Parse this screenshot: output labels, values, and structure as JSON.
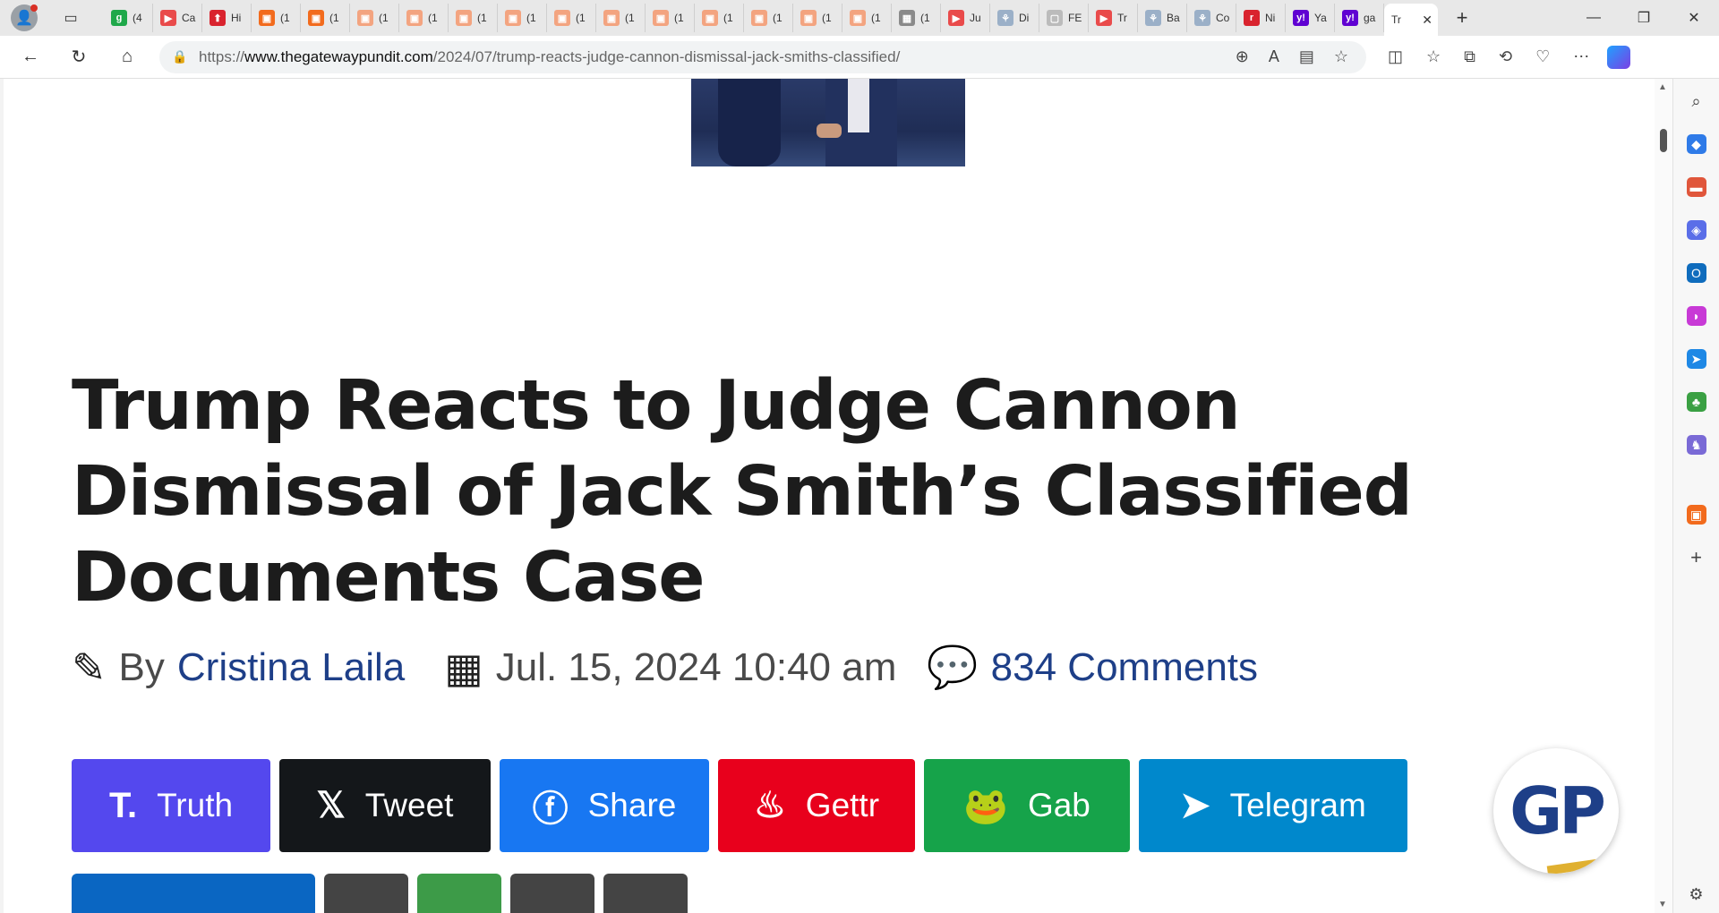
{
  "tabs": [
    {
      "label": "(4",
      "color": "#1fa84a",
      "icon": "g"
    },
    {
      "label": "Ca",
      "color": "#e94b4b",
      "icon": "▶"
    },
    {
      "label": "Hi",
      "color": "#d9232e",
      "icon": "⬆"
    },
    {
      "label": "(1",
      "color": "#f26b1d",
      "icon": "▣"
    },
    {
      "label": "(1",
      "color": "#f26b1d",
      "icon": "▣"
    },
    {
      "label": "(1",
      "color": "#f3a480",
      "icon": "▣"
    },
    {
      "label": "(1",
      "color": "#f3a480",
      "icon": "▣"
    },
    {
      "label": "(1",
      "color": "#f3a480",
      "icon": "▣"
    },
    {
      "label": "(1",
      "color": "#f3a480",
      "icon": "▣"
    },
    {
      "label": "(1",
      "color": "#f3a480",
      "icon": "▣"
    },
    {
      "label": "(1",
      "color": "#f3a480",
      "icon": "▣"
    },
    {
      "label": "(1",
      "color": "#f3a480",
      "icon": "▣"
    },
    {
      "label": "(1",
      "color": "#f3a480",
      "icon": "▣"
    },
    {
      "label": "(1",
      "color": "#f3a480",
      "icon": "▣"
    },
    {
      "label": "(1",
      "color": "#f3a480",
      "icon": "▣"
    },
    {
      "label": "(1",
      "color": "#f3a480",
      "icon": "▣"
    },
    {
      "label": "(1",
      "color": "#8a8a8a",
      "icon": "▦"
    },
    {
      "label": "Ju",
      "color": "#e94b4b",
      "icon": "▶"
    },
    {
      "label": "Di",
      "color": "#9bb0c8",
      "icon": "⚘"
    },
    {
      "label": "FE",
      "color": "#bbbbbb",
      "icon": "▢"
    },
    {
      "label": "Tr",
      "color": "#e94b4b",
      "icon": "▶"
    },
    {
      "label": "Ba",
      "color": "#9bb0c8",
      "icon": "⚘"
    },
    {
      "label": "Co",
      "color": "#9bb0c8",
      "icon": "⚘"
    },
    {
      "label": "Ni",
      "color": "#d9232e",
      "icon": "r"
    },
    {
      "label": "Ya",
      "color": "#6001d2",
      "icon": "y!"
    },
    {
      "label": "ga",
      "color": "#6001d2",
      "icon": "y!"
    },
    {
      "label": "Tr",
      "color": "#ffffff",
      "icon": "",
      "active": true
    }
  ],
  "address_bar": {
    "url_prefix": "https://",
    "url_domain": "www.thegatewaypundit.com",
    "url_path": "/2024/07/trump-reacts-judge-cannon-dismissal-jack-smiths-classified/"
  },
  "article": {
    "headline": "Trump Reacts to Judge Cannon Dismissal of Jack Smith’s Classified Documents Case",
    "by_label": "By",
    "author": "Cristina Laila",
    "date": "Jul. 15, 2024 10:40 am",
    "comments": "834 Comments"
  },
  "share_buttons": {
    "truth": "Truth",
    "tweet": "Tweet",
    "share": "Share",
    "gettr": "Gettr",
    "gab": "Gab",
    "telegram": "Telegram"
  },
  "brand_badge": "GP",
  "colors": {
    "link": "#1e3f88",
    "truth": "#5448ee",
    "x": "#14171a",
    "facebook": "#1877f2",
    "gettr": "#e8001c",
    "gab": "#16a34a",
    "telegram": "#0088cc"
  }
}
